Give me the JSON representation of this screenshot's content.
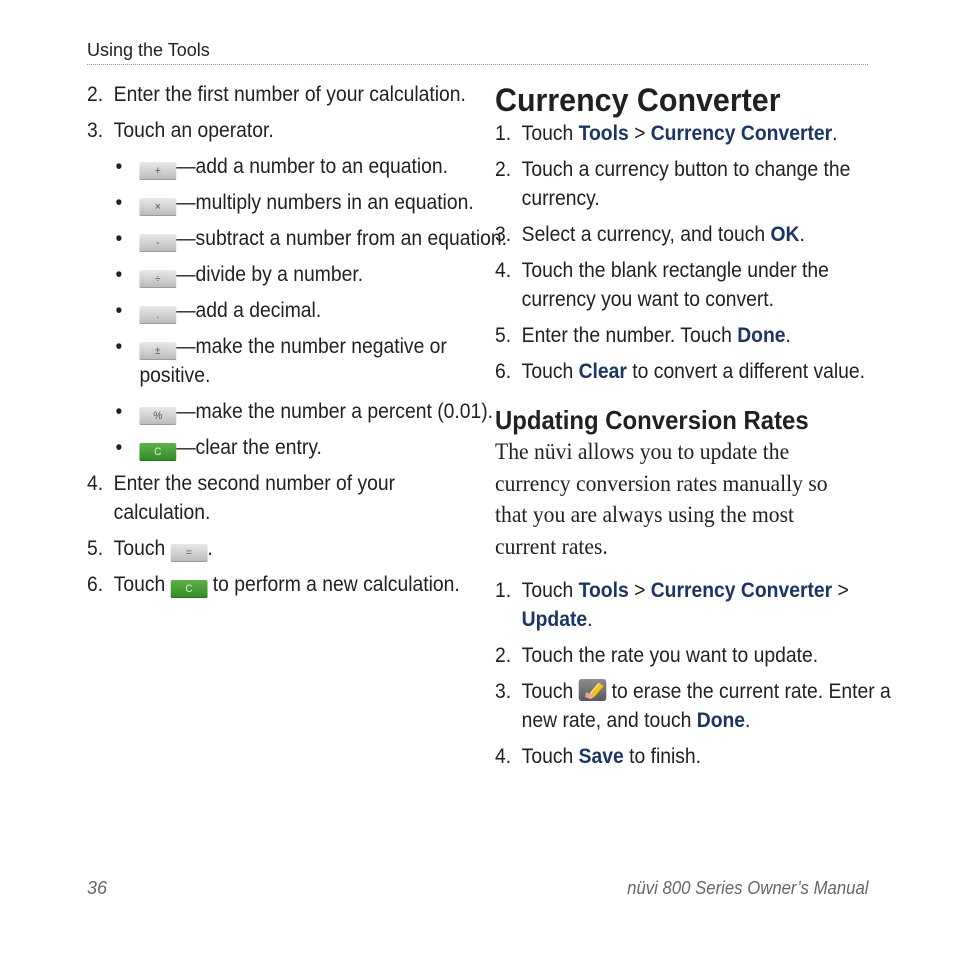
{
  "header": {
    "section": "Using the Tools"
  },
  "left": {
    "step2": {
      "num": "2.",
      "text": "Enter the first number of your calculation."
    },
    "step3": {
      "num": "3.",
      "text": "Touch an operator."
    },
    "operators": [
      {
        "bullet": "•",
        "key": "+",
        "key_name": "plus-key",
        "text": "—add a number to an equation."
      },
      {
        "bullet": "•",
        "key": "×",
        "key_name": "multiply-key",
        "text": "—multiply numbers in an equation."
      },
      {
        "bullet": "•",
        "key": "-",
        "key_name": "minus-key",
        "text": "—subtract a number from an equation."
      },
      {
        "bullet": "•",
        "key": "÷",
        "key_name": "divide-key",
        "text": "—divide by a number."
      },
      {
        "bullet": "•",
        "key": ".",
        "key_name": "decimal-key",
        "text": "—add a decimal."
      },
      {
        "bullet": "•",
        "key": "±",
        "key_name": "plus-minus-key",
        "text": "—make the number negative or positive."
      },
      {
        "bullet": "•",
        "key": "%",
        "key_name": "percent-key",
        "text": "—make the number a percent (0.01)."
      },
      {
        "bullet": "•",
        "key": "C",
        "key_name": "clear-key",
        "text": "—clear the entry."
      }
    ],
    "step4": {
      "num": "4.",
      "text": "Enter the second number of your calculation."
    },
    "step5": {
      "num": "5.",
      "pre": "Touch ",
      "key": "=",
      "post": "."
    },
    "step6": {
      "num": "6.",
      "pre": "Touch ",
      "key": "C",
      "post": " to perform a new calculation."
    }
  },
  "right": {
    "title": "Currency Converter",
    "steps": [
      {
        "num": "1.",
        "pre": "Touch ",
        "b1": "Tools",
        "mid": " > ",
        "b2": "Currency Converter",
        "post": "."
      },
      {
        "num": "2.",
        "text": "Touch a currency button to change the currency."
      },
      {
        "num": "3.",
        "pre": "Select a currency, and touch ",
        "b1": "OK",
        "post": "."
      },
      {
        "num": "4.",
        "text": "Touch the blank rectangle under the currency you want to convert."
      },
      {
        "num": "5.",
        "pre": "Enter the number. Touch ",
        "b1": "Done",
        "post": "."
      },
      {
        "num": "6.",
        "pre": "Touch ",
        "b1": "Clear",
        "post": " to convert a different value."
      }
    ],
    "subtitle": "Updating Conversion Rates",
    "paragraph": "The nüvi allows you to update the currency conversion rates manually so that you are always using the most current rates.",
    "update_steps": [
      {
        "num": "1.",
        "pre": "Touch ",
        "b1": "Tools",
        "mid": " > ",
        "b2": "Currency Converter",
        "mid2": " > ",
        "b3": "Update",
        "post": "."
      },
      {
        "num": "2.",
        "text": "Touch the rate you want to update."
      },
      {
        "num": "3.",
        "pre": "Touch ",
        "icon": "eraser-icon",
        "mid": " to erase the current rate. Enter a new rate, and touch ",
        "b1": "Done",
        "post": "."
      },
      {
        "num": "4.",
        "pre": "Touch ",
        "b1": "Save",
        "post": " to finish."
      }
    ]
  },
  "footer": {
    "page_number": "36",
    "manual_title": "nüvi 800 Series Owner’s Manual"
  },
  "colors": {
    "link_blue": "#1b3567",
    "key_green": "#3a9a2c",
    "text": "#231f20"
  }
}
